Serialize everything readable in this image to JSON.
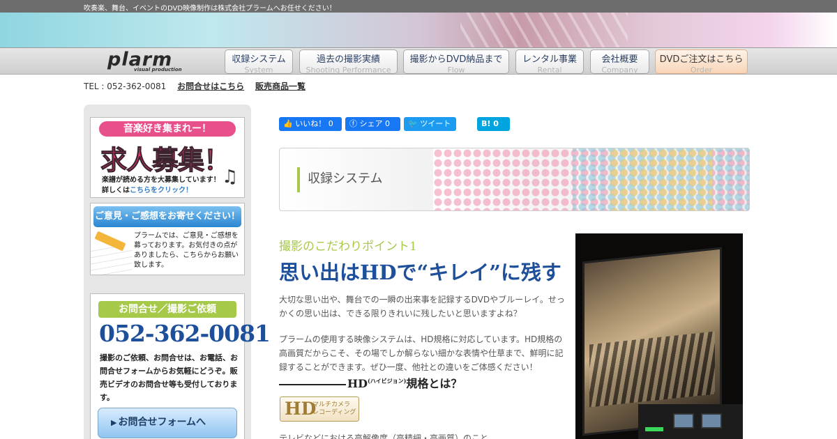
{
  "topbar": {
    "text": "吹奏楽、舞台、イベントのDVD映像制作は株式会社プラームへお任せください！"
  },
  "logo": {
    "word": "plarm",
    "sub": "visual production"
  },
  "nav": [
    {
      "jp": "収録システム",
      "en": "System"
    },
    {
      "jp": "過去の撮影実績",
      "en": "Shooting Performance"
    },
    {
      "jp": "撮影からDVD納品まで",
      "en": "Flow"
    },
    {
      "jp": "レンタル事業",
      "en": "Rental"
    },
    {
      "jp": "会社概要",
      "en": "Company"
    },
    {
      "jp": "DVDご注文はこちら",
      "en": "Order"
    }
  ],
  "contact": {
    "tel": "TEL : 052-362-0081",
    "inquiry": "お問合せはこちら",
    "products": "販売商品一覧"
  },
  "sidebar": {
    "recruit": {
      "pill": "音楽好き集まれー！",
      "big": "求人募集！",
      "line1": "楽譜が読める方を大募集しています！",
      "line2_pre": "詳しくは",
      "line2_link": "こちらをクリック！"
    },
    "feedback": {
      "head": "ご意見・ご感想をお寄せください！",
      "body": "プラームでは、ご意見・ご感想を募っております。お気付きの点がありましたら、こちらからお願い致します。"
    },
    "inquiry": {
      "head": "お問合せ／撮影ご依頼",
      "tel": "052-362-0081",
      "desc": "撮影のご依頼、お問合せは、お電話、お問合せフォームからお気軽にどうぞ。販売ビデオのお問合せ等も受付しております。",
      "button": "お問合せフォームへ"
    }
  },
  "social": {
    "like": "いいね！ 0",
    "share": "シェア 0",
    "tweet": "ツイート",
    "hatena": "B! 0"
  },
  "main": {
    "section_title": "収録システム",
    "point": "撮影のこだわりポイント1",
    "headline": "思い出はHDで“キレイ”に残す",
    "para1": "大切な思い出や、舞台での一瞬の出来事を記録するDVDやブルーレイ。せっかくの思い出は、できる限りきれいに残したいと思いますよね？",
    "para2": "プラームの使用する映像システムは、HD規格に対応しています。HD規格の高画質だからこそ、その場でしか解らない細かな表情や仕草まで、鮮明に記録することができます。ぜひ一度、他社との違いをご体感ください！",
    "hd_heading_pre": "HD",
    "hd_heading_sup": "(ハイビジョン)",
    "hd_heading_post": "規格とは？",
    "hd_logo": "HD",
    "hd_logo_small1": "マルチカメラ",
    "hd_logo_small2": "レコーディング",
    "para3": "テレビなどにおける高解像度（高精細・高画質）のこと"
  },
  "colors": {
    "accent_green": "#a7c94a",
    "brand_blue": "#1e4f9a",
    "pink": "#e0336e"
  }
}
